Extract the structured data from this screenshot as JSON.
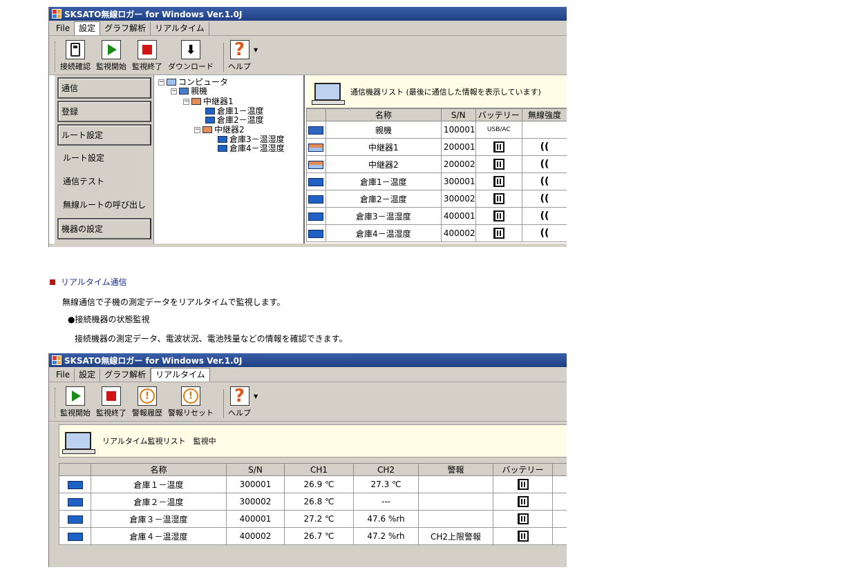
{
  "window1": {
    "title": "SKSATO無線ロガー for Windows Ver.1.0J",
    "menu": [
      "File",
      "設定",
      "グラフ解析",
      "リアルタイム"
    ],
    "active_menu_index": 1,
    "toolbar": [
      "接続確認",
      "監視開始",
      "監視終了",
      "ダウンロード",
      "ヘルプ"
    ],
    "left_nav": {
      "buttons_top": [
        "通信",
        "登録",
        "ルート設定"
      ],
      "sub_items": [
        "ルート設定",
        "通信テスト",
        "無線ルートの呼び出し"
      ],
      "buttons_bottom": [
        "機器の設定"
      ]
    },
    "tree": {
      "root": "コンピュータ",
      "base": "親機",
      "relay1": "中継器1",
      "relay1_children": [
        "倉庫1－温度",
        "倉庫2－温度"
      ],
      "relay2": "中継器2",
      "relay2_children": [
        "倉庫3－温湿度",
        "倉庫4－温湿度"
      ]
    },
    "list_header": "通信機器リスト (最後に通信した情報を表示しています)",
    "table": {
      "columns": [
        "",
        "名称",
        "S/N",
        "バッテリー",
        "無線強度"
      ],
      "rows": [
        {
          "name": "親機",
          "sn": "100001",
          "battery": "USB/AC",
          "signal": ""
        },
        {
          "name": "中継器1",
          "sn": "200001",
          "battery": "",
          "signal": "(("
        },
        {
          "name": "中継器2",
          "sn": "200002",
          "battery": "",
          "signal": "(("
        },
        {
          "name": "倉庫1－温度",
          "sn": "300001",
          "battery": "",
          "signal": "(("
        },
        {
          "name": "倉庫2－温度",
          "sn": "300002",
          "battery": "",
          "signal": "(("
        },
        {
          "name": "倉庫3－温湿度",
          "sn": "400001",
          "battery": "",
          "signal": "(("
        },
        {
          "name": "倉庫4－温湿度",
          "sn": "400002",
          "battery": "",
          "signal": "(("
        }
      ]
    }
  },
  "doc": {
    "section_title": "リアルタイム通信",
    "intro": "無線通信で子機の測定データをリアルタイムで監視します。",
    "sub_title": "●接続機器の状態監視",
    "sub_text": "接続機器の測定データ、電波状況、電池残量などの情報を確認できます。"
  },
  "window2": {
    "title": "SKSATO無線ロガー for Windows Ver.1.0J",
    "menu": [
      "File",
      "設定",
      "グラフ解析",
      "リアルタイム"
    ],
    "active_menu_index": 3,
    "toolbar": [
      "監視開始",
      "監視終了",
      "警報履歴",
      "警報リセット",
      "ヘルプ"
    ],
    "list_header": "リアルタイム監視リスト　監視中",
    "table": {
      "columns": [
        "",
        "名称",
        "S/N",
        "CH1",
        "CH2",
        "警報",
        "バッテリー",
        ""
      ],
      "rows": [
        {
          "name": "倉庫１－温度",
          "sn": "300001",
          "ch1": "26.9 ℃",
          "ch2": "27.3 ℃",
          "alarm": ""
        },
        {
          "name": "倉庫２－温度",
          "sn": "300002",
          "ch1": "26.8 ℃",
          "ch2": "---",
          "alarm": ""
        },
        {
          "name": "倉庫３－温湿度",
          "sn": "400001",
          "ch1": "27.2 ℃",
          "ch2": "47.6 %rh",
          "alarm": ""
        },
        {
          "name": "倉庫４－温湿度",
          "sn": "400002",
          "ch1": "26.7 ℃",
          "ch2": "47.2 %rh",
          "alarm": "CH2上限警報"
        }
      ]
    }
  }
}
